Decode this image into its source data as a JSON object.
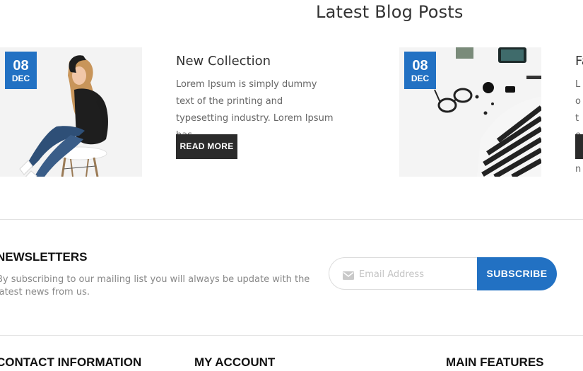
{
  "blog": {
    "title": "Latest Blog Posts",
    "posts": [
      {
        "day": "08",
        "month": "DEC",
        "title": "New Collection",
        "excerpt": "Lorem Ipsum is simply dummy text of the printing and typesetting industry. Lorem Ipsum has...",
        "read_more": "READ MORE"
      },
      {
        "day": "08",
        "month": "DEC",
        "title": "Fa",
        "excerpt": "Lo te in",
        "read_more": ""
      }
    ]
  },
  "newsletter": {
    "title": "NEWSLETTERS",
    "description": "By subscribing to our mailing list you will always be update with the latest news from us.",
    "email_placeholder": "Email Address",
    "subscribe_label": "SUBSCRIBE",
    "accent_color": "#2271c3"
  },
  "footer": {
    "columns": [
      {
        "title": "CONTACT INFORMATION"
      },
      {
        "title": "MY ACCOUNT"
      },
      {
        "title": "MAIN FEATURES"
      }
    ]
  }
}
